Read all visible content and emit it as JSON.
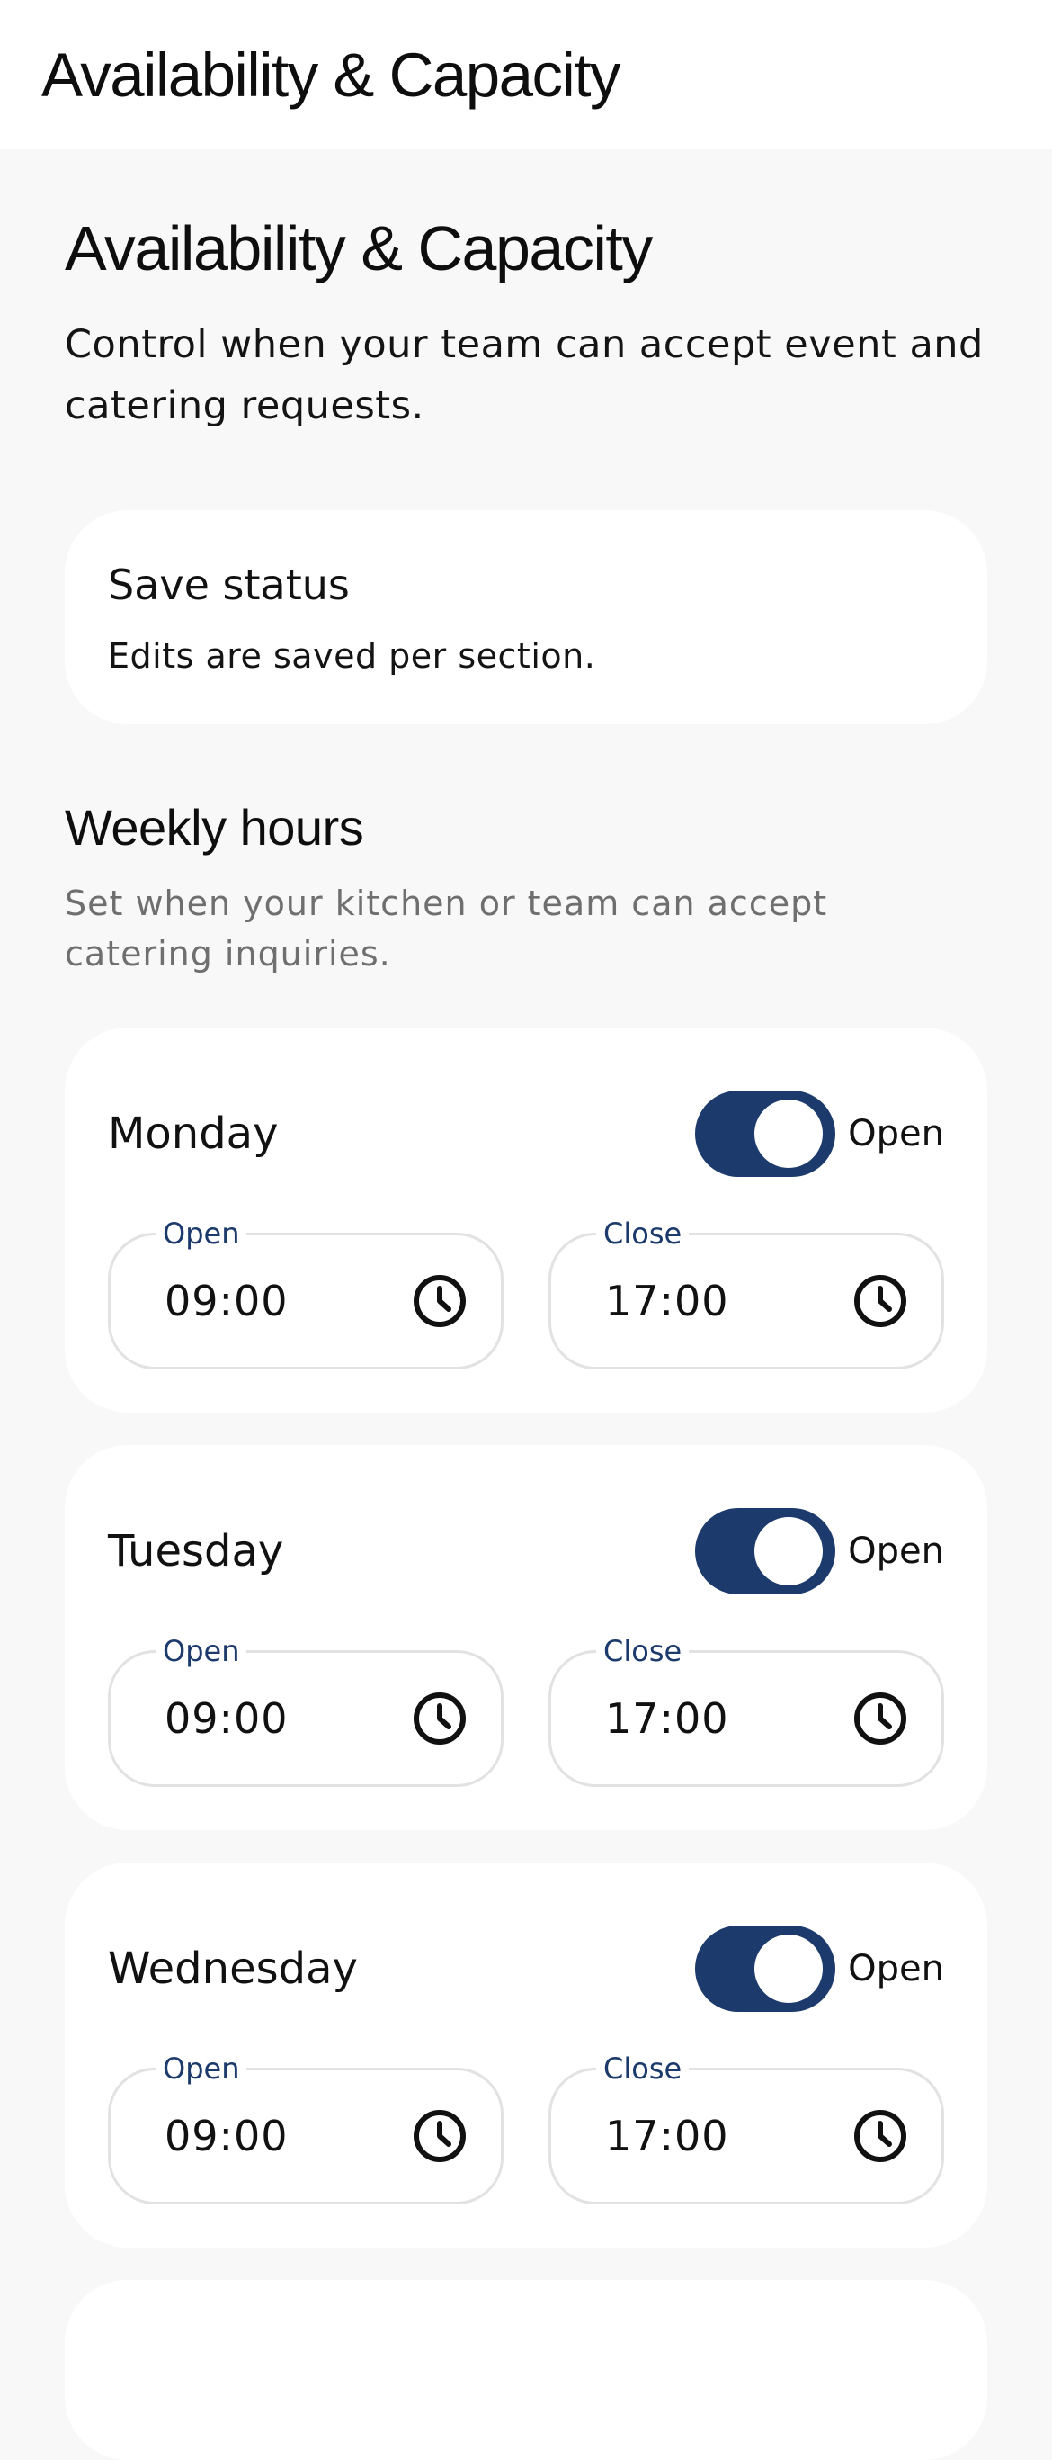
{
  "header": {
    "title": "Availability & Capacity"
  },
  "page": {
    "title": "Availability & Capacity",
    "description": "Control when your team can accept event and catering requests."
  },
  "save_status": {
    "title": "Save status",
    "text": "Edits are saved per section."
  },
  "weekly_hours": {
    "title": "Weekly hours",
    "description": "Set when your kitchen or team can accept catering inquiries.",
    "days": [
      {
        "name": "Monday",
        "status_label": "Open",
        "enabled": true,
        "open_label": "Open",
        "open_time": "09:00",
        "close_label": "Close",
        "close_time": "17:00"
      },
      {
        "name": "Tuesday",
        "status_label": "Open",
        "enabled": true,
        "open_label": "Open",
        "open_time": "09:00",
        "close_label": "Close",
        "close_time": "17:00"
      },
      {
        "name": "Wednesday",
        "status_label": "Open",
        "enabled": true,
        "open_label": "Open",
        "open_time": "09:00",
        "close_label": "Close",
        "close_time": "17:00"
      }
    ]
  },
  "icons": {
    "time_picker": "clock-icon"
  },
  "colors": {
    "accent": "#1c3a6b",
    "background": "#f8f8f8",
    "card": "#ffffff",
    "muted_text": "#6f6f6f",
    "field_border": "#e2e2e2"
  }
}
